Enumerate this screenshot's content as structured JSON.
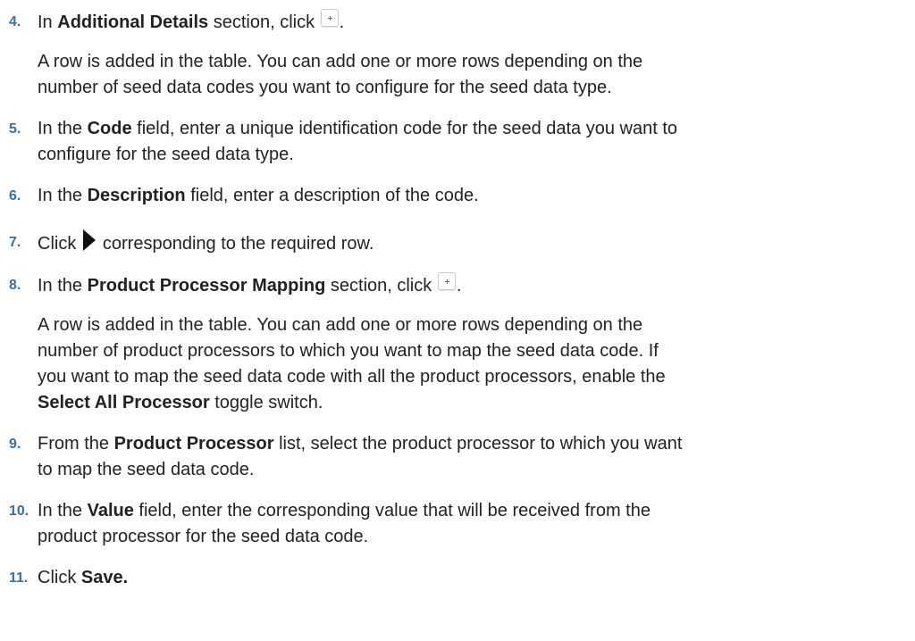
{
  "steps": [
    {
      "num": "4.",
      "parts": [
        "In ",
        "Additional Details",
        " section, click ",
        "."
      ],
      "sub": [
        "A row is added in the table. You can add one or more rows depending on the",
        "number of seed data codes you want to configure for the seed data type."
      ]
    },
    {
      "num": "5.",
      "parts": [
        "In the ",
        "Code",
        " field, enter a unique identification code for the seed data you want to"
      ],
      "line2": "configure for the seed data type."
    },
    {
      "num": "6.",
      "parts": [
        "In the ",
        "Description",
        " field, enter a description of the code."
      ]
    },
    {
      "num": "7.",
      "parts": [
        "Click ",
        "corresponding to the required row."
      ]
    },
    {
      "num": "8.",
      "parts": [
        "In the ",
        "Product Processor Mapping",
        " section, click ",
        "."
      ],
      "sub": [
        "A row is added in the table. You can add one or more rows depending on the",
        "number of product processors to which you want to map the seed data code. If",
        "you want to map the seed data code with all the product processors, enable the"
      ],
      "sub_last_bold": "Select All Processor",
      "sub_last_rest": " toggle switch."
    },
    {
      "num": "9.",
      "parts": [
        "From the ",
        "Product Processor",
        " list, select the product processor to which you want"
      ],
      "line2": "to map the seed data code."
    },
    {
      "num": "10.",
      "parts": [
        "In the ",
        "Value",
        " field, enter the corresponding value that will be received from the"
      ],
      "line2": "product processor for the seed data code."
    },
    {
      "num": "11.",
      "parts": [
        "Click ",
        "Save."
      ]
    }
  ],
  "icons": {
    "add": "plus-icon",
    "expand": "caret-right-icon"
  }
}
